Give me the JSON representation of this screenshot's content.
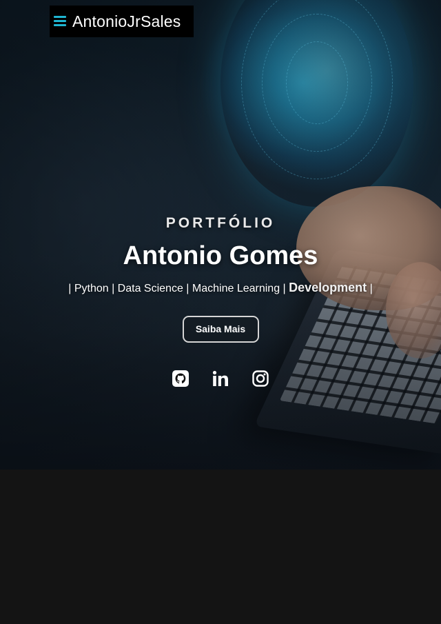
{
  "nav": {
    "brand": "AntonioJrSales",
    "menu_icon": "hamburger-menu-icon",
    "accent_color": "#1fb6d2"
  },
  "hero": {
    "kicker": "PORTFÓLIO",
    "name": "Antonio Gomes",
    "skills_static": "| Python | Data Science | Machine Learning |",
    "skills_typed": "Development",
    "skills_tail": "|",
    "cta_label": "Saiba Mais",
    "socials": [
      {
        "icon": "github-icon"
      },
      {
        "icon": "linkedin-icon"
      },
      {
        "icon": "instagram-icon"
      }
    ]
  },
  "colors": {
    "page_background": "#141414",
    "text": "#ffffff"
  }
}
